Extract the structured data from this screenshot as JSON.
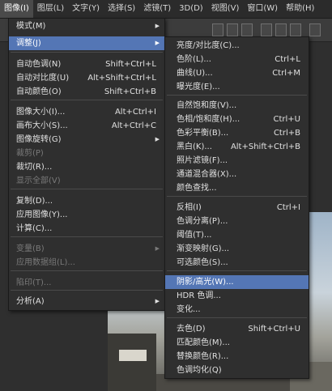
{
  "menubar": {
    "items": [
      "图像(I)",
      "图层(L)",
      "文字(Y)",
      "选择(S)",
      "滤镜(T)",
      "3D(D)",
      "视图(V)",
      "窗口(W)",
      "帮助(H)"
    ]
  },
  "image_menu": {
    "items": [
      {
        "label": "模式(M)",
        "shortcut": "",
        "submenu": true,
        "disabled": false
      },
      {
        "label": "调整(J)",
        "shortcut": "",
        "submenu": true,
        "disabled": false
      },
      {
        "label": "自动色调(N)",
        "shortcut": "Shift+Ctrl+L",
        "submenu": false,
        "disabled": false
      },
      {
        "label": "自动对比度(U)",
        "shortcut": "Alt+Shift+Ctrl+L",
        "submenu": false,
        "disabled": false
      },
      {
        "label": "自动颜色(O)",
        "shortcut": "Shift+Ctrl+B",
        "submenu": false,
        "disabled": false
      },
      {
        "label": "图像大小(I)...",
        "shortcut": "Alt+Ctrl+I",
        "submenu": false,
        "disabled": false
      },
      {
        "label": "画布大小(S)...",
        "shortcut": "Alt+Ctrl+C",
        "submenu": false,
        "disabled": false
      },
      {
        "label": "图像旋转(G)",
        "shortcut": "",
        "submenu": true,
        "disabled": false
      },
      {
        "label": "裁剪(P)",
        "shortcut": "",
        "submenu": false,
        "disabled": true
      },
      {
        "label": "裁切(R)...",
        "shortcut": "",
        "submenu": false,
        "disabled": false
      },
      {
        "label": "显示全部(V)",
        "shortcut": "",
        "submenu": false,
        "disabled": true
      },
      {
        "label": "复制(D)...",
        "shortcut": "",
        "submenu": false,
        "disabled": false
      },
      {
        "label": "应用图像(Y)...",
        "shortcut": "",
        "submenu": false,
        "disabled": false
      },
      {
        "label": "计算(C)...",
        "shortcut": "",
        "submenu": false,
        "disabled": false
      },
      {
        "label": "变量(B)",
        "shortcut": "",
        "submenu": true,
        "disabled": true
      },
      {
        "label": "应用数据组(L)...",
        "shortcut": "",
        "submenu": false,
        "disabled": true
      },
      {
        "label": "陷印(T)...",
        "shortcut": "",
        "submenu": false,
        "disabled": true
      },
      {
        "label": "分析(A)",
        "shortcut": "",
        "submenu": true,
        "disabled": false
      }
    ]
  },
  "adjust_menu": {
    "items": [
      {
        "label": "亮度/对比度(C)...",
        "shortcut": ""
      },
      {
        "label": "色阶(L)...",
        "shortcut": "Ctrl+L"
      },
      {
        "label": "曲线(U)...",
        "shortcut": "Ctrl+M"
      },
      {
        "label": "曝光度(E)...",
        "shortcut": ""
      },
      {
        "label": "自然饱和度(V)...",
        "shortcut": ""
      },
      {
        "label": "色相/饱和度(H)...",
        "shortcut": "Ctrl+U"
      },
      {
        "label": "色彩平衡(B)...",
        "shortcut": "Ctrl+B"
      },
      {
        "label": "黑白(K)...",
        "shortcut": "Alt+Shift+Ctrl+B"
      },
      {
        "label": "照片滤镜(F)...",
        "shortcut": ""
      },
      {
        "label": "通道混合器(X)...",
        "shortcut": ""
      },
      {
        "label": "颜色查找...",
        "shortcut": ""
      },
      {
        "label": "反相(I)",
        "shortcut": "Ctrl+I"
      },
      {
        "label": "色调分离(P)...",
        "shortcut": ""
      },
      {
        "label": "阈值(T)...",
        "shortcut": ""
      },
      {
        "label": "渐变映射(G)...",
        "shortcut": ""
      },
      {
        "label": "可选颜色(S)...",
        "shortcut": ""
      },
      {
        "label": "阴影/高光(W)...",
        "shortcut": ""
      },
      {
        "label": "HDR 色调...",
        "shortcut": ""
      },
      {
        "label": "变化...",
        "shortcut": ""
      },
      {
        "label": "去色(D)",
        "shortcut": "Shift+Ctrl+U"
      },
      {
        "label": "匹配颜色(M)...",
        "shortcut": ""
      },
      {
        "label": "替换颜色(R)...",
        "shortcut": ""
      },
      {
        "label": "色调均化(Q)",
        "shortcut": ""
      }
    ]
  },
  "colors": {
    "highlight": "#5476b5",
    "menu_bg": "#2f2f2f",
    "disabled_text": "#7a7a7a"
  }
}
